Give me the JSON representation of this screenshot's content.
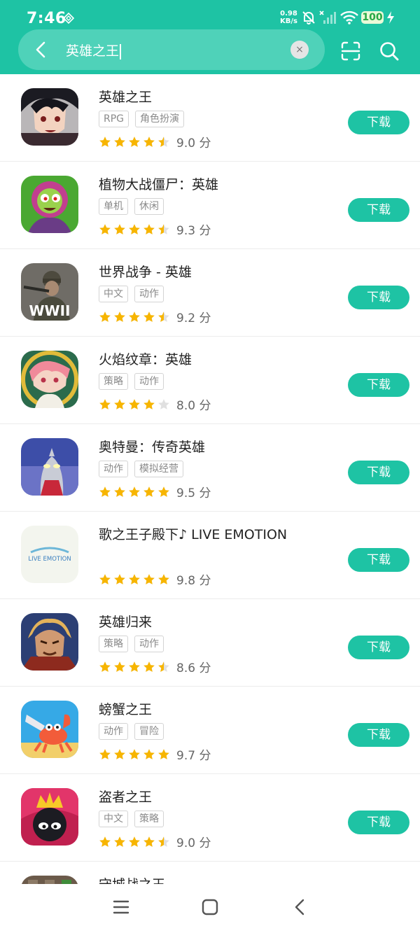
{
  "status_bar": {
    "time": "7:46",
    "speed_value": "0.98",
    "speed_unit": "KB/s",
    "battery": "100"
  },
  "search": {
    "query": "英雄之王",
    "clear_symbol": "×"
  },
  "download_label": "下载",
  "apps": [
    {
      "name": "英雄之王",
      "tags": [
        "RPG",
        "角色扮演"
      ],
      "score": "9.0 分",
      "stars": 4.5,
      "icon": "anime-hero-icon"
    },
    {
      "name": "植物大战僵尸：英雄",
      "tags": [
        "单机",
        "休闲"
      ],
      "score": "9.3 分",
      "stars": 4.5,
      "icon": "zombie-plant-icon"
    },
    {
      "name": "世界战争 - 英雄",
      "tags": [
        "中文",
        "动作"
      ],
      "score": "9.2 分",
      "stars": 4.5,
      "icon": "ww2-soldier-icon"
    },
    {
      "name": "火焰纹章：英雄",
      "tags": [
        "策略",
        "动作"
      ],
      "score": "8.0 分",
      "stars": 4,
      "icon": "fire-emblem-icon"
    },
    {
      "name": "奥特曼：传奇英雄",
      "tags": [
        "动作",
        "模拟经营"
      ],
      "score": "9.5 分",
      "stars": 5,
      "icon": "ultraman-icon"
    },
    {
      "name": "歌之王子殿下♪ LIVE EMOTION",
      "tags": [],
      "score": "9.8 分",
      "stars": 5,
      "icon": "live-emotion-logo-icon",
      "icon_text": "LIVE EMOTION"
    },
    {
      "name": "英雄归来",
      "tags": [
        "策略",
        "动作"
      ],
      "score": "8.6 分",
      "stars": 4.5,
      "icon": "warrior-hero-icon"
    },
    {
      "name": "螃蟹之王",
      "tags": [
        "动作",
        "冒险"
      ],
      "score": "9.7 分",
      "stars": 5,
      "icon": "crab-king-icon"
    },
    {
      "name": "盗者之王",
      "tags": [
        "中文",
        "策略"
      ],
      "score": "9.0 分",
      "stars": 4.5,
      "icon": "thief-king-icon"
    },
    {
      "name": "守城战之王",
      "tags": [],
      "score": "",
      "stars": 0,
      "icon": "castle-king-icon"
    }
  ],
  "icon_text": {
    "wwii": "WWII"
  },
  "colors": {
    "accent": "#1ec3a4",
    "star": "#f7b500",
    "star_empty": "#e0e0e0"
  }
}
